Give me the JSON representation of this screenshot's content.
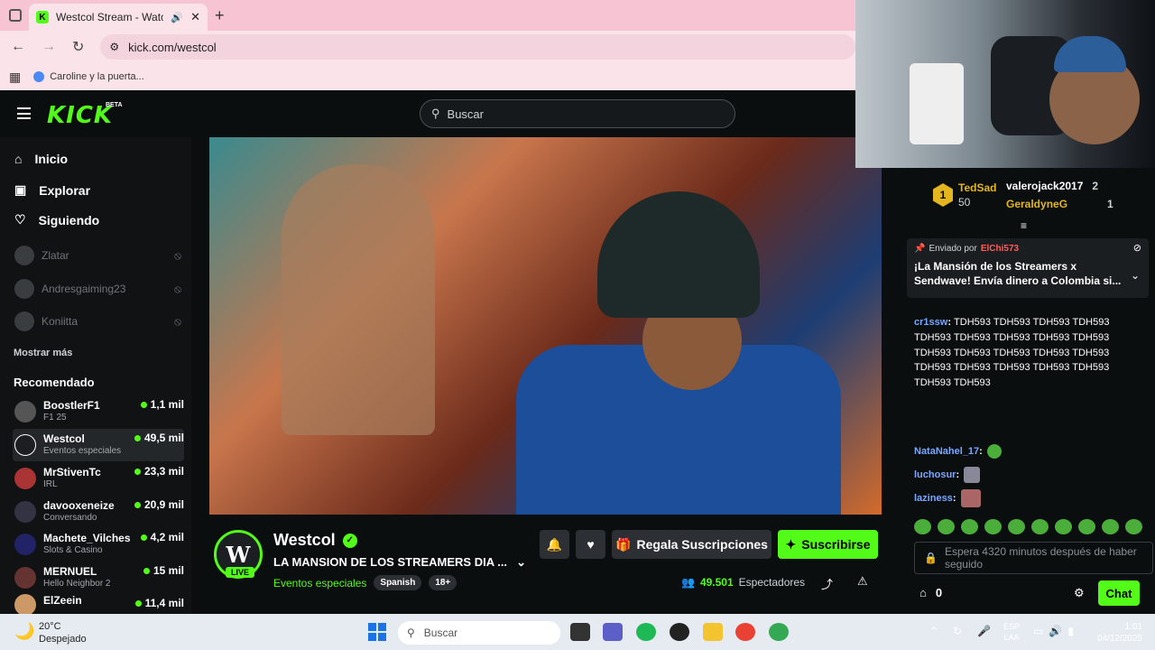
{
  "browser": {
    "tab_title": "Westcol Stream - Watch Liv",
    "url": "kick.com/westcol",
    "bookmark": "Caroline y la puerta..."
  },
  "header": {
    "logo": "KICK",
    "beta": "BETA",
    "search_placeholder": "Buscar"
  },
  "sidebar": {
    "nav": [
      "Inicio",
      "Explorar",
      "Siguiendo"
    ],
    "following": [
      "Zlatar",
      "Andresgaiming23",
      "Koniitta"
    ],
    "show_more": "Mostrar más",
    "recommended_title": "Recomendado",
    "recommended": [
      {
        "name": "BoostlerF1",
        "category": "F1 25",
        "viewers": "1,1 mil"
      },
      {
        "name": "Westcol",
        "category": "Eventos especiales",
        "viewers": "49,5 mil"
      },
      {
        "name": "MrStivenTc",
        "category": "IRL",
        "viewers": "23,3 mil"
      },
      {
        "name": "davooxeneize",
        "category": "Conversando",
        "viewers": "20,9 mil"
      },
      {
        "name": "Machete_Vilches",
        "category": "Slots & Casino",
        "viewers": "4,2 mil"
      },
      {
        "name": "MERNUEL",
        "category": "Hello Neighbor 2",
        "viewers": "15 mil"
      },
      {
        "name": "ElZeein",
        "category": "",
        "viewers": "11,4 mil"
      }
    ]
  },
  "stream": {
    "channel": "Westcol",
    "live": "LIVE",
    "title": "LA MANSION DE LOS STREAMERS DIA ...",
    "category": "Eventos especiales",
    "tags": [
      "Spanish",
      "18+"
    ],
    "gift_label": "Regala Suscripciones",
    "subscribe_label": "Suscribirse",
    "viewers": "49.501",
    "viewers_label": "Espectadores"
  },
  "chat": {
    "leaderboard": [
      {
        "rank": "1",
        "name": "TedSad",
        "value": "50"
      },
      {
        "name": "valerojack2017",
        "value": "2"
      },
      {
        "name": "GeraldyneG",
        "value": "1"
      }
    ],
    "pinned_by": "Enviado por",
    "pinned_user": "ElChi573",
    "pinned_msg": "¡La Mansión de los Streamers x Sendwave! Envía dinero a Colombia si...",
    "messages": [
      {
        "user": "cr1ssw",
        "text": "TDH593 TDH593 TDH593 TDH593 TDH593 TDH593 TDH593 TDH593 TDH593 TDH593 TDH593 TDH593 TDH593 TDH593 TDH593 TDH593 TDH593 TDH593 TDH593 TDH593 TDH593"
      },
      {
        "user": "NataNahel_17",
        "text": ""
      },
      {
        "user": "luchosur",
        "text": ""
      },
      {
        "user": "laziness",
        "text": ""
      }
    ],
    "input_placeholder": "Espera 4320 minutos después de haber seguido",
    "points": "0",
    "chat_button": "Chat"
  },
  "taskbar": {
    "weather_temp": "20°C",
    "weather_desc": "Despejado",
    "search": "Buscar",
    "lang1": "ESP",
    "lang2": "LAA",
    "time": "1:01",
    "date": "04/12/2025"
  }
}
